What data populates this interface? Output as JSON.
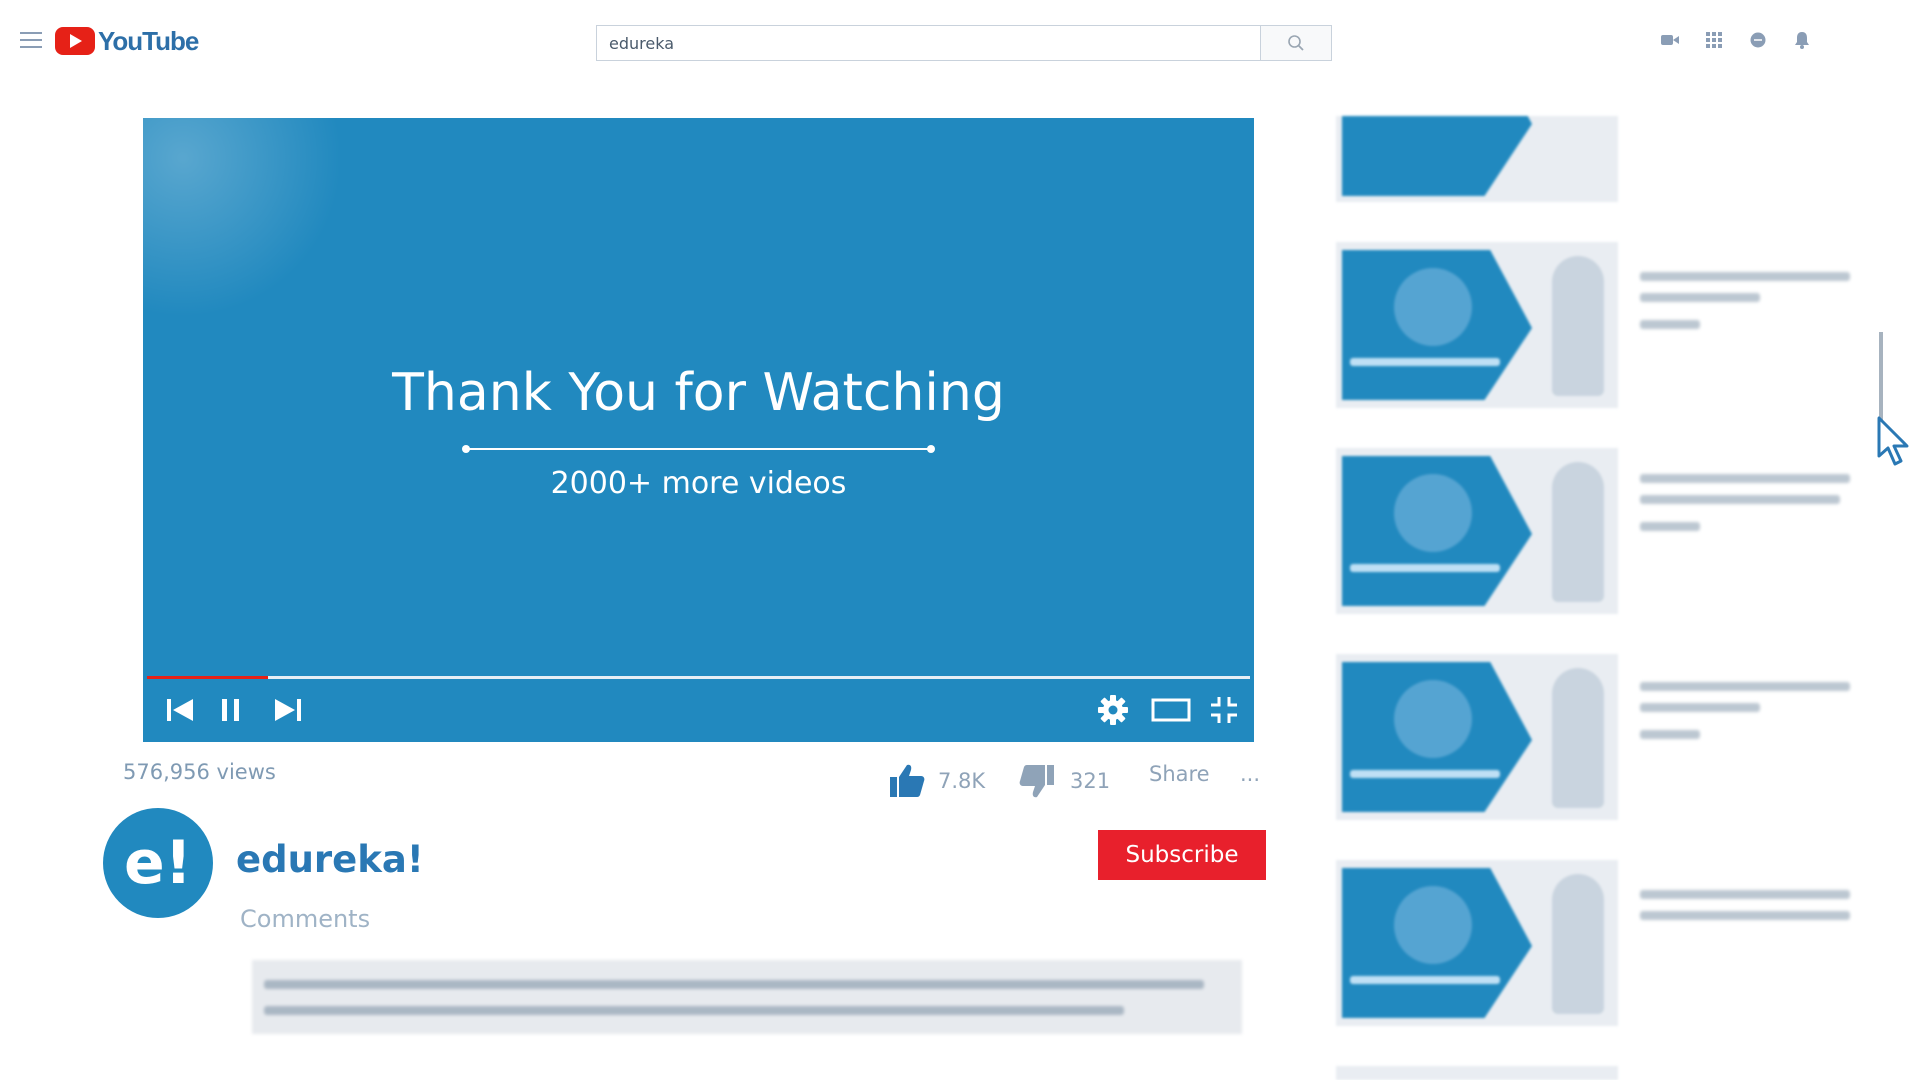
{
  "header": {
    "logo_text": "YouTube",
    "search_value": "edureka",
    "icons": [
      "video-camera-icon",
      "apps-grid-icon",
      "chat-icon",
      "notification-bell-icon"
    ]
  },
  "player": {
    "title_overlay": "Thank You for Watching",
    "subtitle_overlay": "2000+ more videos",
    "progress_fraction": 0.11,
    "controls": [
      "previous-icon",
      "pause-icon",
      "next-icon",
      "settings-icon",
      "theater-mode-icon",
      "exit-fullscreen-icon"
    ]
  },
  "video": {
    "views": "576,956 views",
    "likes": "7.8K",
    "dislikes": "321",
    "share_label": "Share",
    "more_label": "..."
  },
  "channel": {
    "avatar_text": "e!",
    "name": "edureka!",
    "subscribe_label": "Subscribe"
  },
  "comments": {
    "heading": "Comments"
  },
  "colors": {
    "brand_blue": "#2189bf",
    "subscribe_red": "#e8202c",
    "youtube_red": "#e62117"
  }
}
